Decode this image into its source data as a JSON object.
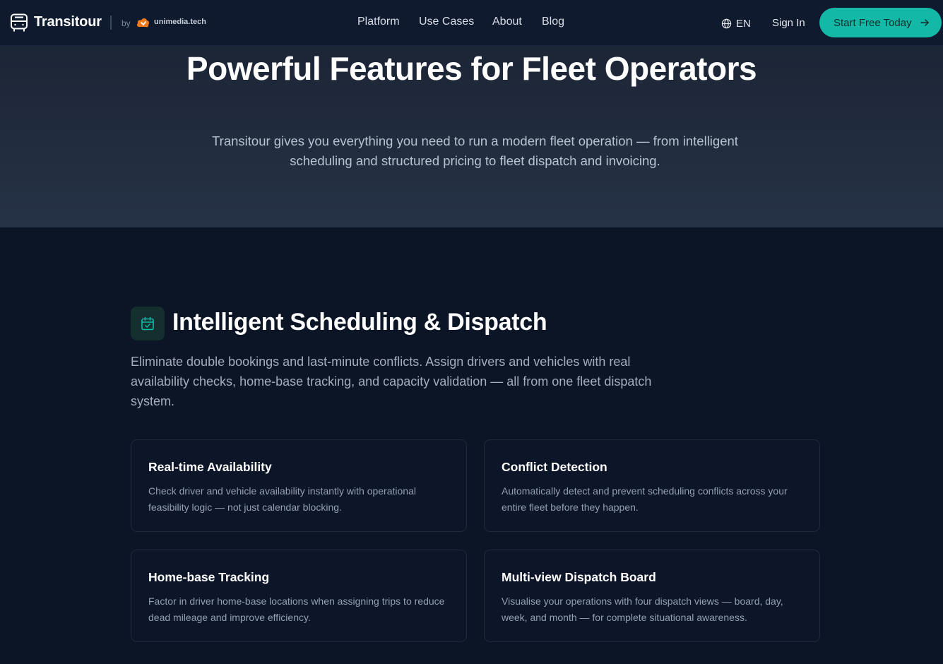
{
  "nav": {
    "brand": "Transitour",
    "by": "by",
    "partner": "unimedia.tech",
    "links": [
      "Platform",
      "Use Cases",
      "About",
      "Blog"
    ],
    "language": "EN",
    "sign_in": "Sign In",
    "cta": "Start Free Today"
  },
  "hero": {
    "title": "Powerful Features for Fleet Operators",
    "subtitle": "Transitour gives you everything you need to run a modern fleet operation — from intelligent scheduling and structured pricing to fleet dispatch and invoicing."
  },
  "section": {
    "icon": "calendar-check-icon",
    "title": "Intelligent Scheduling & Dispatch",
    "description": "Eliminate double bookings and last-minute conflicts. Assign drivers and vehicles with real availability checks, home-base tracking, and capacity validation — all from one fleet dispatch system.",
    "cards": [
      {
        "title": "Real-time Availability",
        "description": "Check driver and vehicle availability instantly with operational feasibility logic — not just calendar blocking."
      },
      {
        "title": "Conflict Detection",
        "description": "Automatically detect and prevent scheduling conflicts across your entire fleet before they happen."
      },
      {
        "title": "Home-base Tracking",
        "description": "Factor in driver home-base locations when assigning trips to reduce dead mileage and improve efficiency."
      },
      {
        "title": "Multi-view Dispatch Board",
        "description": "Visualise your operations with four dispatch views — board, day, week, and month — for complete situational awareness."
      }
    ]
  },
  "colors": {
    "accent": "#14b8a6",
    "background": "#0c1526",
    "hero_background": "#232e40"
  }
}
